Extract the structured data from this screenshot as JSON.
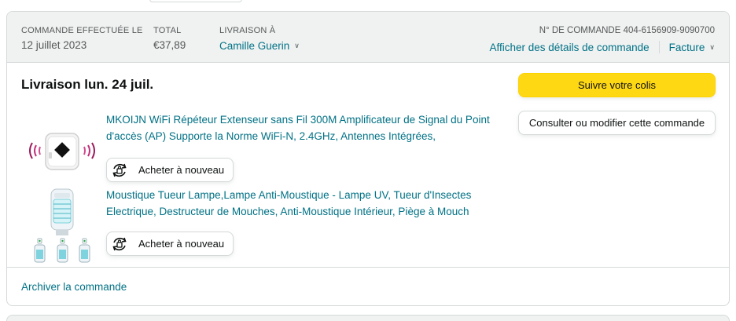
{
  "header": {
    "order_placed_label": "COMMANDE EFFECTUÉE LE",
    "order_placed_value": "12 juillet 2023",
    "total_label": "TOTAL",
    "total_value": "€37,89",
    "ship_to_label": "LIVRAISON À",
    "ship_to_value": "Camille Guerin",
    "order_number_label": "N° DE COMMANDE",
    "order_number_value": "404-6156909-9090700",
    "details_link": "Afficher des détails de commande",
    "invoice_link": "Facture"
  },
  "delivery": {
    "title": "Livraison lun. 24 juil."
  },
  "actions": {
    "track_package": "Suivre votre colis",
    "view_edit_order": "Consulter ou modifier cette commande"
  },
  "products": [
    {
      "title": "MKOIJN WiFi Répéteur Extenseur sans Fil 300M Amplificateur de Signal du Point d'accès (AP) Supporte la Norme WiFi-N, 2.4GHz, Antennes Intégrées,",
      "buy_again": "Acheter à nouveau",
      "image_icon": "wifi-repeater-icon"
    },
    {
      "title": "Moustique Tueur Lampe,Lampe Anti-Moustique - Lampe UV, Tueur d'Insectes Electrique, Destructeur de Mouches, Anti-Moustique Intérieur, Piège à Mouch",
      "buy_again": "Acheter à nouveau",
      "image_icon": "mosquito-lamp-icon"
    }
  ],
  "footer": {
    "archive_link": "Archiver la commande"
  },
  "colors": {
    "link": "#007185",
    "primary_button": "#ffd814",
    "header_bg": "#f0f2f2",
    "border": "#d5d9d9"
  }
}
